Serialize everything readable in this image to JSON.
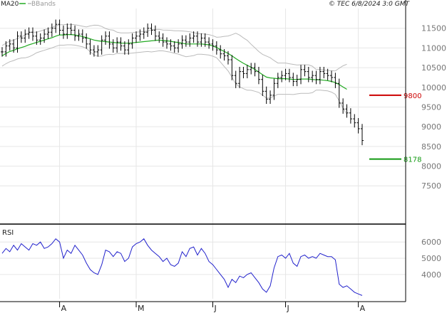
{
  "header": {
    "ma_label": "MA20",
    "bb_label": "BBands",
    "copyright": "© TEC 6/8/2024 3:0 GMT"
  },
  "colors": {
    "ma": "#22aa22",
    "bands": "#bbbbbb",
    "bars": "#000000",
    "rsi": "#2222cc",
    "resistance": "#cc0000",
    "support": "#119911",
    "grid": "#e6e6e6"
  },
  "chart_data": [
    {
      "type": "ohlc",
      "title": "",
      "indicators": [
        "MA20",
        "BBands"
      ],
      "y_ticks": [
        7500,
        8000,
        8500,
        9000,
        9500,
        10000,
        10500,
        11000,
        11500
      ],
      "ylim": [
        6800,
        12000
      ],
      "x_labels": [
        "A",
        "M",
        "J",
        "J",
        "A"
      ],
      "x_label_index": [
        15,
        35,
        55,
        74,
        93
      ],
      "levels": [
        {
          "value": 9800,
          "label": "9800",
          "color": "#cc0000"
        },
        {
          "value": 8178,
          "label": "8178",
          "color": "#119911"
        }
      ],
      "close": [
        10900,
        11050,
        11100,
        11000,
        11300,
        11250,
        11350,
        11400,
        11300,
        11200,
        11250,
        11350,
        11400,
        11500,
        11600,
        11450,
        11350,
        11500,
        11450,
        11300,
        11350,
        11250,
        11100,
        10950,
        10900,
        10950,
        11200,
        11300,
        11100,
        11000,
        11150,
        11050,
        10950,
        11100,
        11250,
        11300,
        11350,
        11400,
        11500,
        11450,
        11300,
        11250,
        11150,
        11100,
        11050,
        11000,
        11100,
        11200,
        11150,
        11250,
        11300,
        11150,
        11250,
        11150,
        11100,
        11050,
        10950,
        10850,
        10800,
        10700,
        10300,
        10100,
        10400,
        10350,
        10450,
        10500,
        10400,
        10200,
        9900,
        9700,
        9800,
        10100,
        10250,
        10300,
        10350,
        10250,
        10150,
        10200,
        10450,
        10400,
        10250,
        10300,
        10200,
        10400,
        10350,
        10300,
        10250,
        10100,
        9600,
        9450,
        9350,
        9200,
        9100,
        8950,
        8650
      ],
      "ma": [
        10800,
        10860,
        10910,
        10940,
        10980,
        11010,
        11040,
        11080,
        11110,
        11140,
        11170,
        11200,
        11230,
        11260,
        11300,
        11330,
        11330,
        11340,
        11340,
        11330,
        11310,
        11290,
        11260,
        11230,
        11200,
        11180,
        11170,
        11160,
        11150,
        11140,
        11130,
        11120,
        11120,
        11120,
        11130,
        11140,
        11150,
        11160,
        11170,
        11180,
        11190,
        11200,
        11190,
        11180,
        11170,
        11150,
        11140,
        11120,
        11100,
        11100,
        11100,
        11100,
        11100,
        11090,
        11080,
        11050,
        11010,
        10960,
        10910,
        10860,
        10800,
        10730,
        10670,
        10610,
        10560,
        10510,
        10450,
        10390,
        10320,
        10260,
        10240,
        10230,
        10220,
        10220,
        10220,
        10210,
        10200,
        10200,
        10210,
        10210,
        10210,
        10200,
        10190,
        10190,
        10180,
        10170,
        10150,
        10120,
        10070,
        10010,
        9950
      ]
    },
    {
      "type": "line",
      "title": "RSI",
      "y_ticks": [
        4000,
        5000,
        6000
      ],
      "ylim": [
        2500,
        6800
      ],
      "values": [
        5300,
        5600,
        5400,
        5800,
        5500,
        5900,
        5700,
        5500,
        5900,
        5800,
        6000,
        5600,
        5700,
        5900,
        6200,
        6000,
        5000,
        5500,
        5300,
        5800,
        5500,
        5200,
        4700,
        4300,
        4100,
        4000,
        4600,
        5500,
        5400,
        5100,
        5400,
        5300,
        4800,
        5000,
        5700,
        5900,
        6000,
        6200,
        5800,
        5500,
        5300,
        5100,
        4800,
        5000,
        4600,
        4500,
        4700,
        5400,
        5100,
        5600,
        5700,
        5200,
        5600,
        5300,
        4800,
        4600,
        4300,
        4000,
        3700,
        3200,
        3700,
        3500,
        3900,
        3800,
        4000,
        4100,
        3800,
        3500,
        3100,
        2900,
        3300,
        4400,
        5100,
        5200,
        5000,
        5300,
        4700,
        4500,
        5100,
        5200,
        5000,
        5100,
        5000,
        5300,
        5200,
        5100,
        5100,
        4900,
        3400,
        3200,
        3300,
        3100,
        2900,
        2800,
        2700
      ]
    }
  ]
}
